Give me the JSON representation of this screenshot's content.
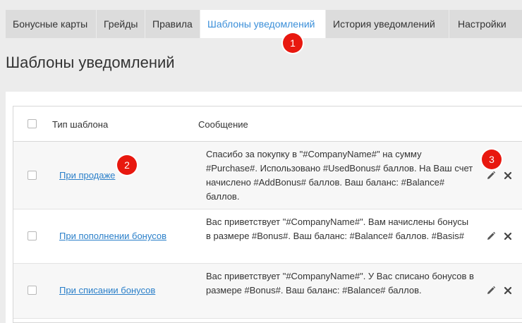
{
  "tabs": [
    {
      "label": "Бонусные карты"
    },
    {
      "label": "Грейды"
    },
    {
      "label": "Правила"
    },
    {
      "label": "Шаблоны уведомлений"
    },
    {
      "label": "История уведомлений"
    },
    {
      "label": "Настройки"
    }
  ],
  "active_tab": "Шаблоны уведомлений",
  "markers": [
    "1",
    "2",
    "3"
  ],
  "page_title": "Шаблоны уведомлений",
  "table": {
    "headers": {
      "type": "Тип шаблона",
      "message": "Сообщение"
    },
    "rows": [
      {
        "type": "При продаже",
        "message": "Спасибо за покупку в \"#CompanyName#\" на сумму #Purchase#. Использовано #UsedBonus# баллов. На Ваш счет начислено #AddBonus# баллов. Ваш баланс: #Balance# баллов."
      },
      {
        "type": "При пополнении бонусов",
        "message": "Вас приветствует \"#CompanyName#\". Вам начислены бонусы в размере #Bonus#. Ваш баланс: #Balance# баллов. #Basis#"
      },
      {
        "type": "При списании бонусов",
        "message": "Вас приветствует \"#CompanyName#\". У Вас списано бонусов в размере #Bonus#. Ваш баланс: #Balance# баллов."
      }
    ]
  },
  "colors": {
    "accent": "#3b8fd9",
    "link": "#2a7fc9",
    "marker": "#e8180f",
    "tabbar": "#dcdcdc",
    "background": "#ececec"
  },
  "icons": {
    "edit": "pencil-icon",
    "delete": "close-icon"
  }
}
